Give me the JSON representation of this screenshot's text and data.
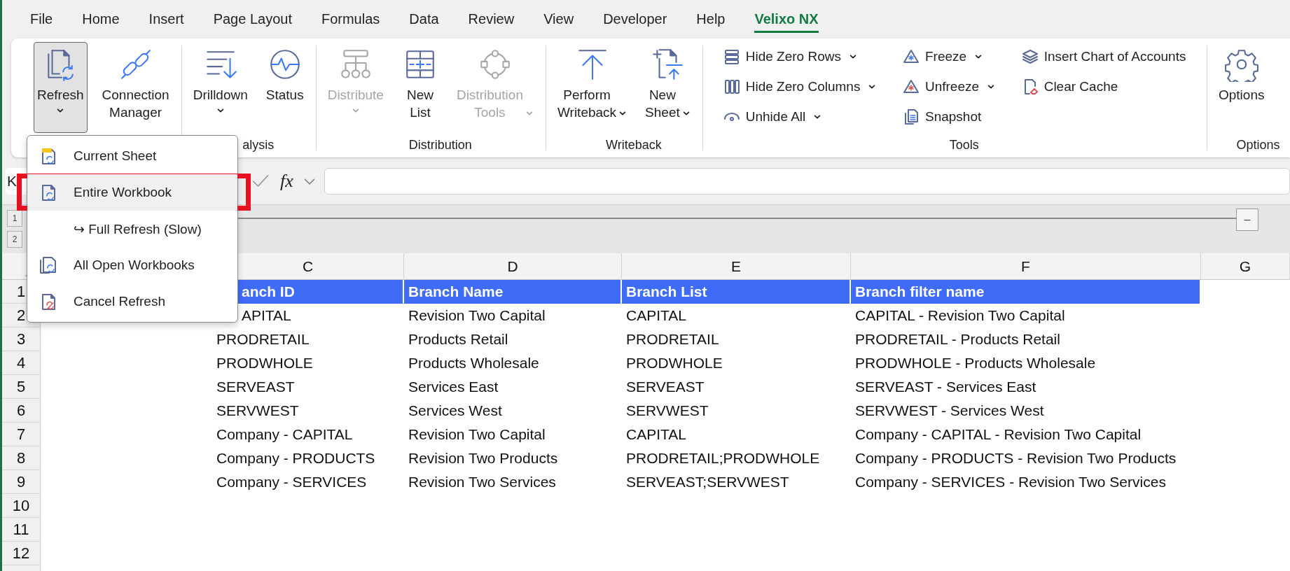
{
  "menu_tabs": [
    {
      "label": "File",
      "selected": false
    },
    {
      "label": "Home",
      "selected": false
    },
    {
      "label": "Insert",
      "selected": false
    },
    {
      "label": "Page Layout",
      "selected": false
    },
    {
      "label": "Formulas",
      "selected": false
    },
    {
      "label": "Data",
      "selected": false
    },
    {
      "label": "Review",
      "selected": false
    },
    {
      "label": "View",
      "selected": false
    },
    {
      "label": "Developer",
      "selected": false
    },
    {
      "label": "Help",
      "selected": false
    },
    {
      "label": "Velixo NX",
      "selected": true
    }
  ],
  "ribbon": {
    "groups": [
      {
        "buttons": [
          {
            "kind": "split",
            "label": "Refresh",
            "caret": true,
            "expanded": true,
            "disabled": false
          },
          {
            "kind": "large",
            "label": "Connection Manager",
            "caret": false,
            "expanded": false,
            "disabled": false
          }
        ]
      },
      {
        "label": "alysis",
        "buttons": [
          {
            "kind": "split",
            "label": "Drilldown",
            "caret": true,
            "expanded": false,
            "disabled": false
          },
          {
            "kind": "large",
            "label": "Status",
            "caret": false,
            "expanded": false,
            "disabled": false
          }
        ]
      },
      {
        "label": "Distribution",
        "buttons": [
          {
            "kind": "split",
            "label": "Distribute",
            "caret": true,
            "expanded": false,
            "disabled": true
          },
          {
            "kind": "large",
            "label": "New List",
            "caret": false,
            "expanded": false,
            "disabled": false
          },
          {
            "kind": "large",
            "label": "Distribution Tools",
            "caret": true,
            "expanded": false,
            "disabled": true
          }
        ]
      },
      {
        "label": "Writeback",
        "buttons": [
          {
            "kind": "large",
            "label": "Perform Writeback",
            "caret": true,
            "expanded": false,
            "disabled": false
          },
          {
            "kind": "large",
            "label": "New Sheet",
            "caret": true,
            "expanded": false,
            "disabled": false
          }
        ]
      },
      {
        "label": "Tools",
        "buttons": [
          {
            "kind": "small",
            "label": "Hide Zero Rows",
            "caret": true
          },
          {
            "kind": "small",
            "label": "Hide Zero Columns",
            "caret": true
          },
          {
            "kind": "small",
            "label": "Unhide All",
            "caret": true
          },
          {
            "kind": "small",
            "label": "Freeze",
            "caret": true
          },
          {
            "kind": "small",
            "label": "Unfreeze",
            "caret": true
          },
          {
            "kind": "small",
            "label": "Snapshot",
            "caret": false
          },
          {
            "kind": "small",
            "label": "Insert Chart of Accounts",
            "caret": false
          },
          {
            "kind": "small",
            "label": "Clear Cache",
            "caret": false
          }
        ]
      },
      {
        "label": "Options",
        "buttons": [
          {
            "kind": "large",
            "label": "Options",
            "caret": false,
            "expanded": false,
            "disabled": false
          }
        ]
      }
    ]
  },
  "formula_bar": {
    "name_box": "K",
    "function_label": "fx"
  },
  "outline": {
    "levels": [
      "1",
      "2"
    ],
    "collapse": "–"
  },
  "sheet": {
    "columns": [
      "C",
      "D",
      "E",
      "F",
      "G"
    ],
    "rows": [
      {
        "number": "1",
        "kind": "header",
        "cells": [
          "anch ID",
          "Branch Name",
          "Branch List",
          "Branch filter name"
        ]
      },
      {
        "number": "2",
        "kind": "data",
        "cells": [
          "APITAL",
          "Revision Two Capital",
          "CAPITAL",
          "CAPITAL - Revision Two Capital"
        ]
      },
      {
        "number": "3",
        "kind": "data",
        "cells": [
          "PRODRETAIL",
          "Products Retail",
          "PRODRETAIL",
          "PRODRETAIL - Products Retail"
        ]
      },
      {
        "number": "4",
        "kind": "data",
        "cells": [
          "PRODWHOLE",
          "Products Wholesale",
          "PRODWHOLE",
          "PRODWHOLE - Products Wholesale"
        ]
      },
      {
        "number": "5",
        "kind": "data",
        "cells": [
          "SERVEAST",
          "Services East",
          "SERVEAST",
          "SERVEAST - Services East"
        ]
      },
      {
        "number": "6",
        "kind": "data",
        "cells": [
          "SERVWEST",
          "Services West",
          "SERVWEST",
          "SERVWEST - Services West"
        ]
      },
      {
        "number": "7",
        "kind": "data",
        "cells": [
          "Company - CAPITAL",
          "Revision Two Capital",
          "CAPITAL",
          "Company - CAPITAL - Revision Two Capital"
        ]
      },
      {
        "number": "8",
        "kind": "data",
        "cells": [
          "Company - PRODUCTS",
          "Revision Two Products",
          "PRODRETAIL;PRODWHOLE",
          "Company - PRODUCTS - Revision Two Products"
        ]
      },
      {
        "number": "9",
        "kind": "data",
        "cells": [
          "Company - SERVICES",
          "Revision Two Services",
          "SERVEAST;SERVWEST",
          "Company - SERVICES - Revision Two Services"
        ]
      },
      {
        "number": "10"
      },
      {
        "number": "11"
      },
      {
        "number": "12"
      }
    ]
  },
  "menu": {
    "items": [
      {
        "label": "Current Sheet",
        "selected": false,
        "outlined": false
      },
      {
        "label": "Entire Workbook",
        "selected": true,
        "outlined": true
      },
      {
        "label": "↪ Full Refresh (Slow)",
        "selected": false,
        "outlined": false
      },
      {
        "label": "All Open Workbooks",
        "selected": false,
        "outlined": false
      },
      {
        "label": "Cancel Refresh",
        "selected": false,
        "outlined": false
      }
    ]
  }
}
